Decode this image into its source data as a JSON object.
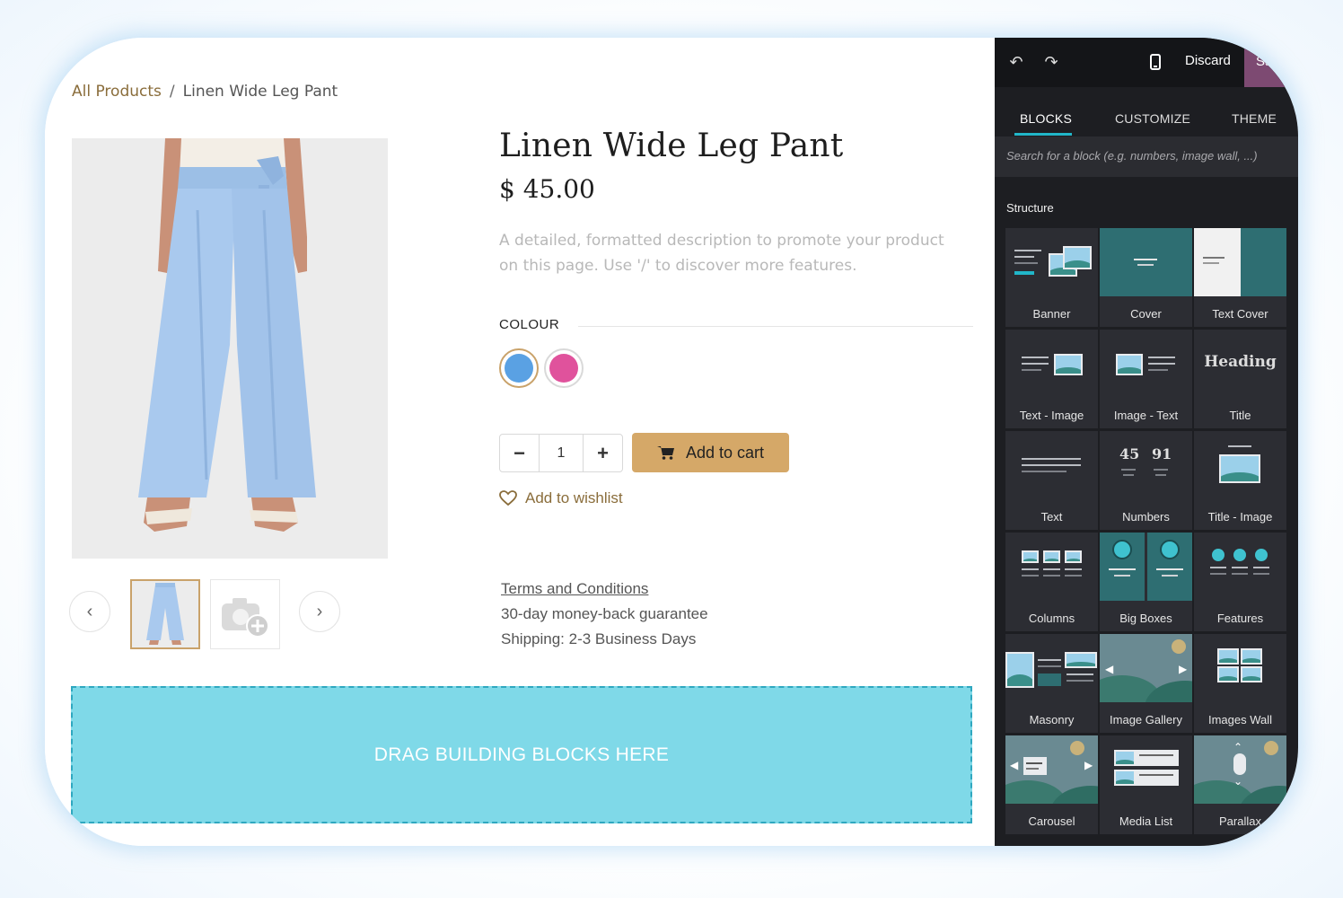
{
  "breadcrumb": {
    "parent": "All Products",
    "separator": "/",
    "current": "Linen Wide Leg Pant"
  },
  "product": {
    "title": "Linen Wide Leg Pant",
    "price": "$ 45.00",
    "description": "A detailed, formatted description to promote your product on this page. Use '/' to discover more features.",
    "colour_label": "COLOUR",
    "colours": [
      "#5aa1e3",
      "#e0529c"
    ],
    "quantity": "1",
    "minus": "−",
    "plus": "+",
    "add_to_cart": "Add to cart",
    "wishlist": "Add to wishlist",
    "terms": "Terms and Conditions",
    "guarantee": "30-day money-back guarantee",
    "shipping": "Shipping: 2-3 Business Days"
  },
  "dropzone": {
    "label": "DRAG BUILDING BLOCKS HERE"
  },
  "editor": {
    "discard": "Discard",
    "save": "Sa",
    "tabs": [
      "BLOCKS",
      "CUSTOMIZE",
      "THEME"
    ],
    "search_placeholder": "Search for a block (e.g. numbers, image wall, ...)",
    "section": "Structure",
    "blocks": [
      "Banner",
      "Cover",
      "Text Cover",
      "Text - Image",
      "Image - Text",
      "Title",
      "Text",
      "Numbers",
      "Title - Image",
      "Columns",
      "Big Boxes",
      "Features",
      "Masonry",
      "Image Gallery",
      "Images Wall",
      "Carousel",
      "Media List",
      "Parallax"
    ],
    "preview_text": {
      "heading": "Heading",
      "num1": "45",
      "num2": "91"
    }
  },
  "colors": {
    "accent": "#d5a868",
    "link": "#8a6d3b",
    "dropzone": "#7fd9e8",
    "panel": "#1d1e22",
    "tab_underline": "#21b6c9",
    "save": "#7d4a72"
  }
}
